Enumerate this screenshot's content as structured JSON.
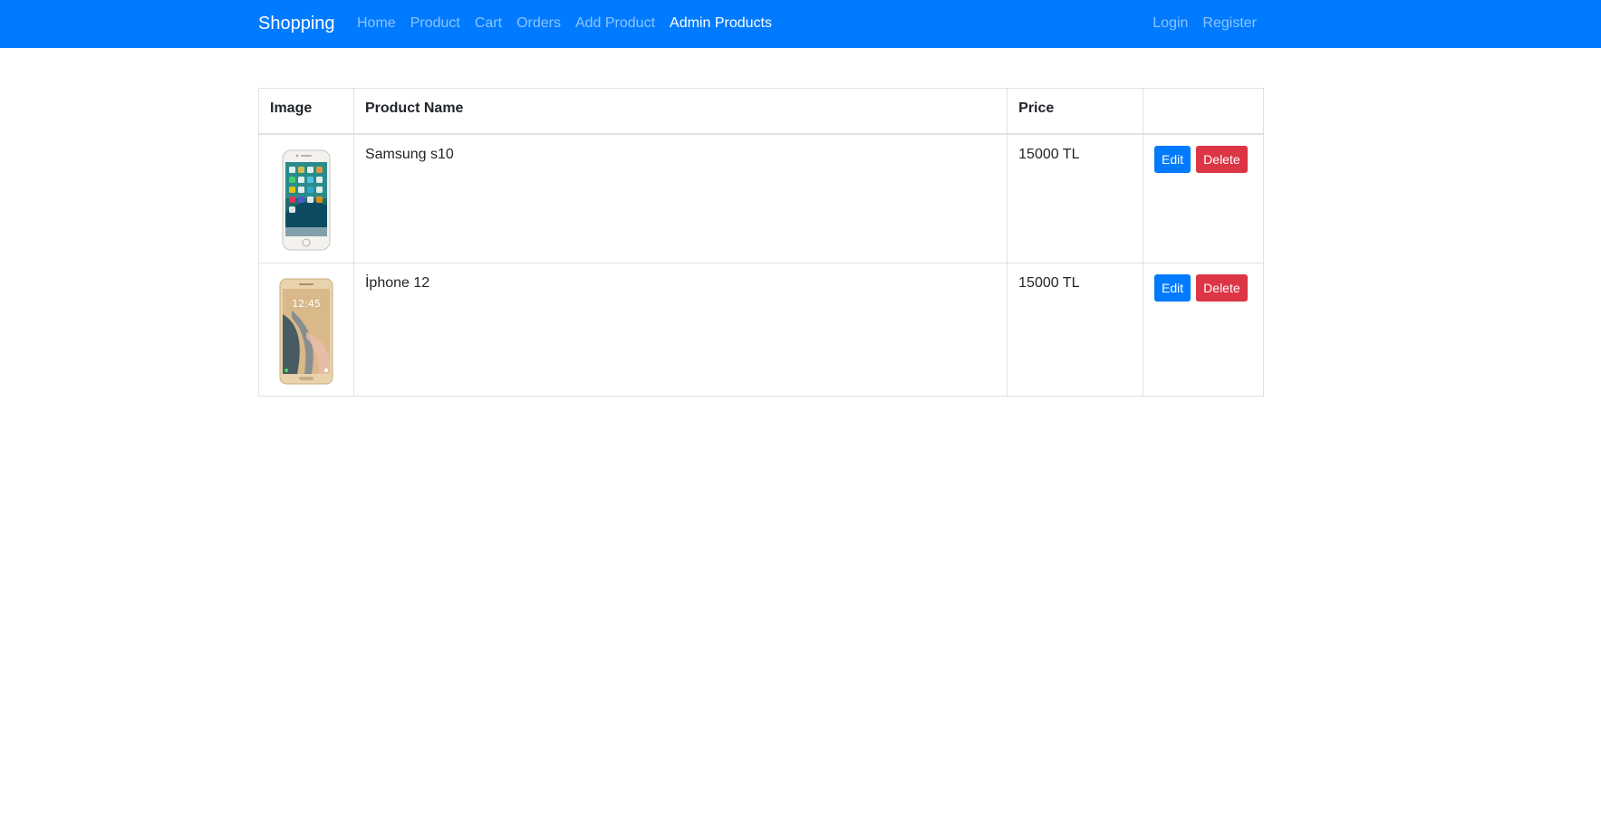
{
  "navbar": {
    "brand": "Shopping",
    "left_links": [
      {
        "label": "Home",
        "active": false
      },
      {
        "label": "Product",
        "active": false
      },
      {
        "label": "Cart",
        "active": false
      },
      {
        "label": "Orders",
        "active": false
      },
      {
        "label": "Add Product",
        "active": false
      },
      {
        "label": "Admin Products",
        "active": true
      }
    ],
    "right_links": [
      {
        "label": "Login"
      },
      {
        "label": "Register"
      }
    ],
    "background_color": "#007bff"
  },
  "table": {
    "headers": [
      "Image",
      "Product Name",
      "Price",
      ""
    ],
    "rows": [
      {
        "image": "phone-white-icon",
        "name": "Samsung s10",
        "price": "15000 TL",
        "edit_label": "Edit",
        "delete_label": "Delete"
      },
      {
        "image": "phone-gold-icon",
        "name": "İphone 12",
        "price": "15000 TL",
        "edit_label": "Edit",
        "delete_label": "Delete"
      }
    ]
  },
  "colors": {
    "edit_button": "#007bff",
    "delete_button": "#dc3545"
  }
}
